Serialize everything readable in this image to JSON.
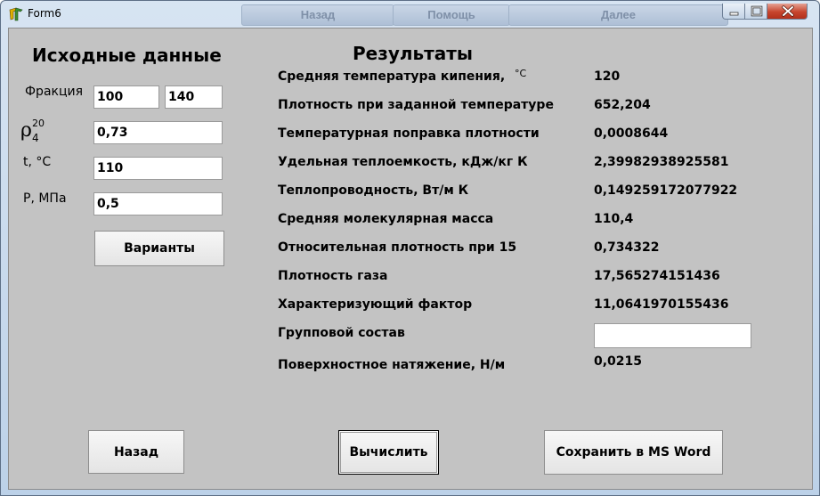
{
  "window": {
    "title": "Form6",
    "background_tabs": [
      "Назад",
      "Помощь",
      "Далее"
    ]
  },
  "inputs_section": {
    "heading": "Исходные данные",
    "fraction_label": "Фракция",
    "fraction_from": "100",
    "fraction_to": "140",
    "density_label": {
      "symbol": "ρ",
      "sup": "20",
      "sub": "4"
    },
    "density_value": "0,73",
    "temp_label": "t, °C",
    "temp_value": "110",
    "pressure_label": "P, МПа",
    "pressure_value": "0,5",
    "variants_button": "Варианты"
  },
  "results_section": {
    "heading": "Результаты",
    "rows": [
      {
        "label": "Средняя температура кипения,",
        "unit": "°C",
        "value": "120"
      },
      {
        "label": "Плотность при заданной температуре",
        "value": "652,204"
      },
      {
        "label": "Температурная поправка плотности",
        "value": "0,0008644"
      },
      {
        "label": "Удельная теплоемкость, кДж/кг К",
        "value": "2,39982938925581"
      },
      {
        "label": "Теплопроводность, Вт/м К",
        "value": "0,149259172077922"
      },
      {
        "label": "Средняя молекулярная масса",
        "value": "110,4"
      },
      {
        "label": "Относительная плотность при 15",
        "value": "0,734322"
      },
      {
        "label": "Плотность газа",
        "value": "17,565274151436"
      },
      {
        "label": "Характеризующий фактор",
        "value": "11,0641970155436"
      },
      {
        "label": "Групповой состав",
        "value": ""
      },
      {
        "label": "Поверхностное натяжение, Н/м",
        "value": "0,0215"
      }
    ]
  },
  "buttons": {
    "back": "Назад",
    "calculate": "Вычислить",
    "save_word": "Сохранить в MS Word"
  },
  "colors": {
    "form_background": "#c3c3c3",
    "close_button": "#c7452e"
  }
}
